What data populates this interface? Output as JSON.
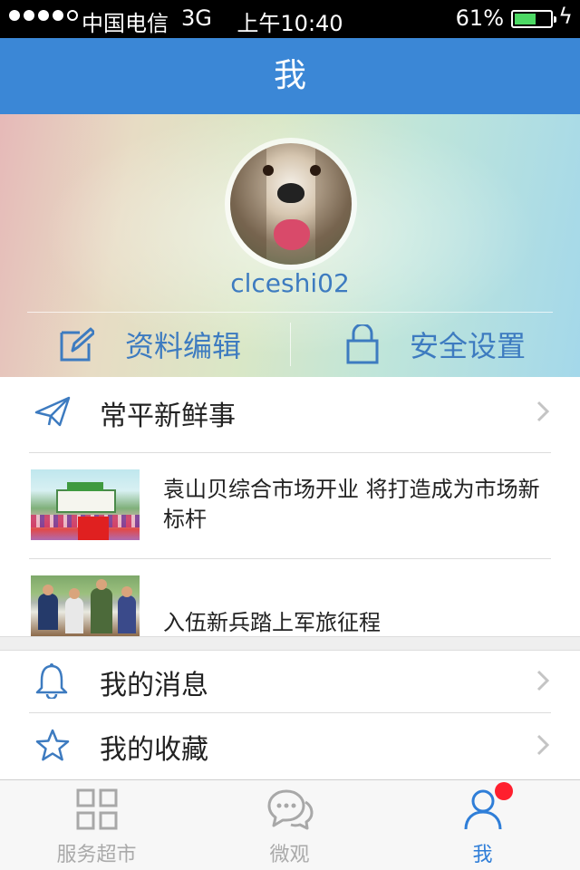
{
  "status_bar": {
    "carrier": "中国电信",
    "network": "3G",
    "time": "上午10:40",
    "battery_percent": "61%",
    "battery_level": 0.61,
    "signal_bars": 4,
    "signal_bars_total": 5
  },
  "nav": {
    "title": "我"
  },
  "profile": {
    "username": "clceshi02",
    "actions": [
      {
        "label": "资料编辑",
        "icon": "edit-icon"
      },
      {
        "label": "安全设置",
        "icon": "lock-icon"
      }
    ]
  },
  "news": {
    "header_label": "常平新鲜事",
    "header_icon": "paper-plane-icon",
    "items": [
      {
        "title": "袁山贝综合市场开业 将打造成为市场新标杆"
      },
      {
        "title": "入伍新兵踏上军旅征程"
      }
    ]
  },
  "menu": {
    "items": [
      {
        "label": "我的消息",
        "icon": "bell-icon"
      },
      {
        "label": "我的收藏",
        "icon": "star-icon"
      }
    ]
  },
  "tabs": [
    {
      "label": "服务超市",
      "icon": "grid-icon",
      "active": false
    },
    {
      "label": "微观",
      "icon": "chat-icon",
      "active": false
    },
    {
      "label": "我",
      "icon": "person-icon",
      "active": true,
      "has_badge": true
    }
  ],
  "colors": {
    "accent": "#3b87d6",
    "active_tab": "#2f7ed8",
    "badge": "#ff1f2e"
  }
}
